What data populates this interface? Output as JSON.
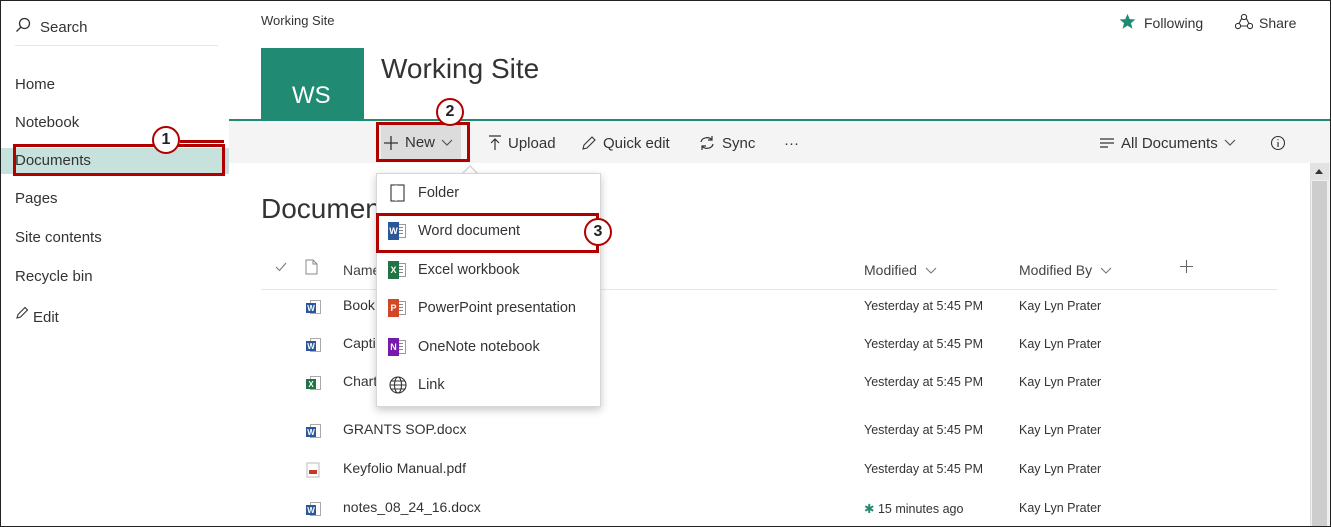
{
  "nav": {
    "search_label": "Search",
    "items": [
      "Home",
      "Notebook",
      "Documents",
      "Pages",
      "Site contents",
      "Recycle bin"
    ],
    "edit_label": "Edit"
  },
  "header": {
    "breadcrumb": "Working Site",
    "site_title": "Working Site",
    "logo_text": "WS",
    "following_label": "Following",
    "share_label": "Share"
  },
  "commandbar": {
    "new_label": "New",
    "upload_label": "Upload",
    "quick_edit_label": "Quick edit",
    "sync_label": "Sync",
    "more_label": "···",
    "view_label": "All Documents"
  },
  "library": {
    "heading": "Documents",
    "columns": {
      "name": "Name",
      "modified": "Modified",
      "modified_by": "Modified By"
    },
    "rows": [
      {
        "name": "Book",
        "type": "word",
        "modified": "Yesterday at 5:45 PM",
        "modified_by": "Kay Lyn Prater"
      },
      {
        "name": "Capti",
        "type": "word",
        "modified": "Yesterday at 5:45 PM",
        "modified_by": "Kay Lyn Prater"
      },
      {
        "name": "Chart",
        "type": "excel",
        "modified": "Yesterday at 5:45 PM",
        "modified_by": "Kay Lyn Prater"
      },
      {
        "name": "GRANTS SOP.docx",
        "type": "word",
        "modified": "Yesterday at 5:45 PM",
        "modified_by": "Kay Lyn Prater"
      },
      {
        "name": "Keyfolio Manual.pdf",
        "type": "pdf",
        "modified": "Yesterday at 5:45 PM",
        "modified_by": "Kay Lyn Prater"
      },
      {
        "name": "notes_08_24_16.docx",
        "type": "word",
        "modified": "15 minutes ago",
        "modified_by": "Kay Lyn Prater"
      }
    ]
  },
  "new_menu": {
    "items": [
      "Folder",
      "Word document",
      "Excel workbook",
      "PowerPoint presentation",
      "OneNote notebook",
      "Link"
    ]
  },
  "callouts": [
    "1",
    "2",
    "3"
  ],
  "colors": {
    "brand": "#208a73",
    "callout": "#b00000",
    "word": "#2b579a",
    "excel": "#217346",
    "powerpoint": "#d24726",
    "onenote": "#7719aa"
  }
}
